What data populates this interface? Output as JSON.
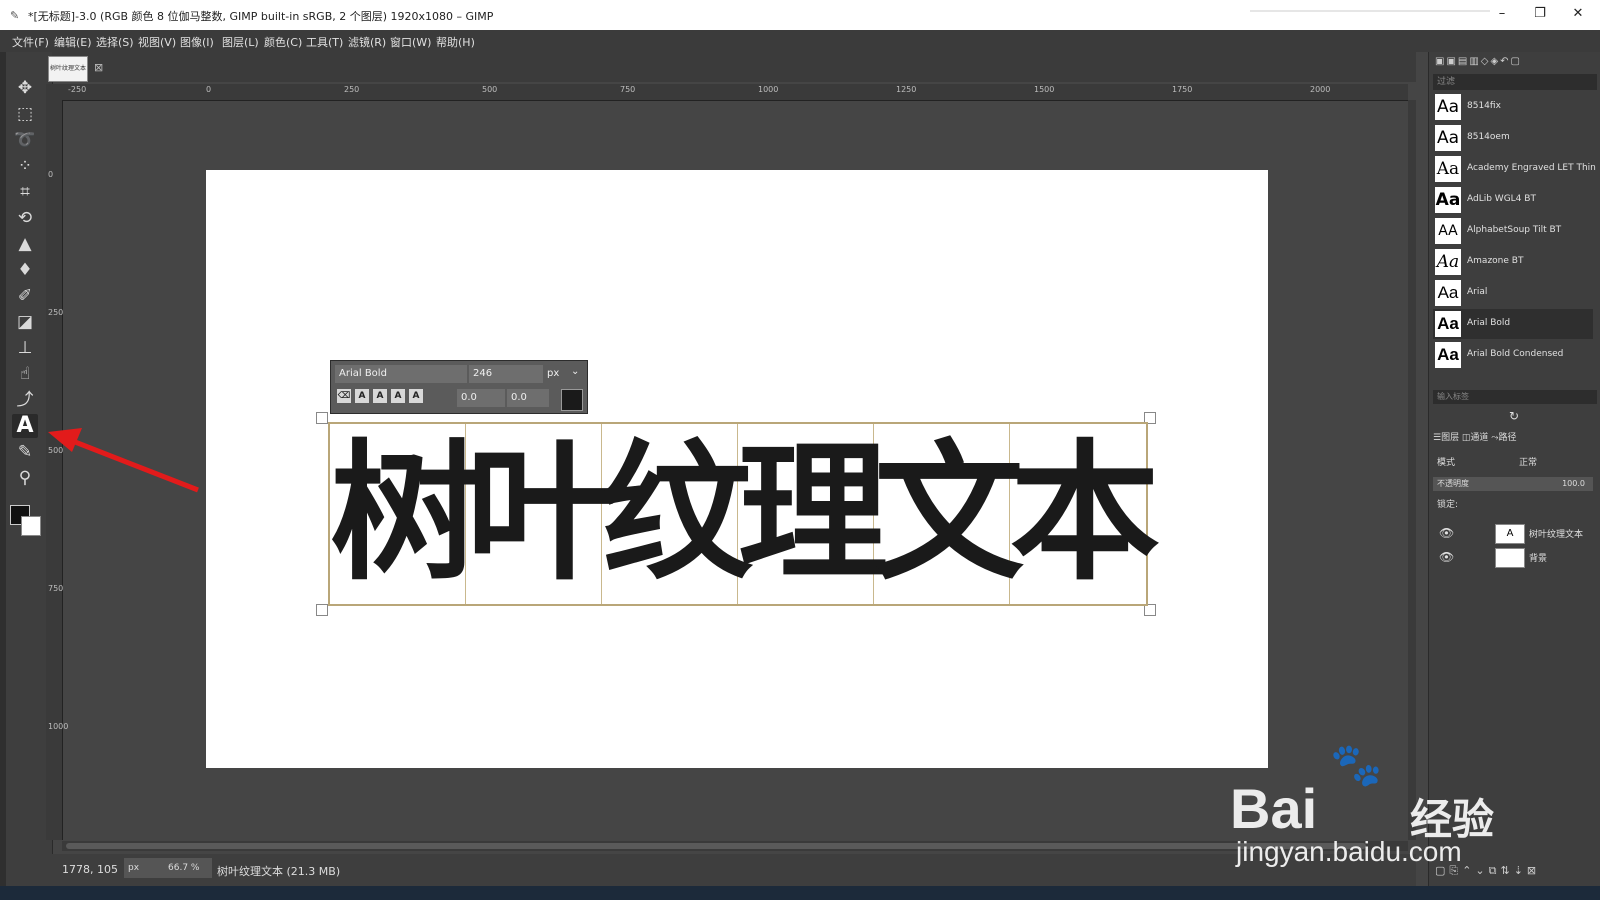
{
  "window": {
    "title": "*[无标题]-3.0 (RGB 颜色 8 位伽马整数, GIMP built-in sRGB, 2 个图层) 1920x1080 – GIMP",
    "controls": [
      "–",
      "❐",
      "✕"
    ]
  },
  "menubar": [
    "文件(F)",
    "编辑(E)",
    "选择(S)",
    "视图(V)",
    "图像(I)",
    "图层(L)",
    "颜色(C)",
    "工具(T)",
    "滤镜(R)",
    "窗口(W)",
    "帮助(H)"
  ],
  "image_tab": {
    "thumb_text": "树叶纹理文本",
    "close": "⊠"
  },
  "rulers": {
    "horizontal": [
      "-250",
      "0",
      "250",
      "500",
      "750",
      "1000",
      "1250",
      "1500",
      "1750",
      "2000"
    ],
    "vertical": [
      "0",
      "250",
      "500",
      "750",
      "1000"
    ]
  },
  "canvas_text": [
    "树",
    "叶",
    "纹",
    "理",
    "文",
    "本"
  ],
  "text_toolbar": {
    "font": "Arial Bold",
    "size": "246",
    "unit": "px",
    "offset_x": "0.0",
    "offset_y": "0.0",
    "buttons": [
      "⌫",
      "A",
      "A",
      "A",
      "A"
    ]
  },
  "status": {
    "coords": "1778, 105",
    "unit": "px",
    "zoom": "66.7 %",
    "info": "树叶纹理文本 (21.3 MB)"
  },
  "fonts_panel": {
    "filter_placeholder": "过滤",
    "tags_placeholder": "输入标签",
    "fonts": [
      {
        "preview": "Aa",
        "name": "8514fix"
      },
      {
        "preview": "Aa",
        "name": "8514oem"
      },
      {
        "preview": "Aa",
        "name": "Academy Engraved LET Thin"
      },
      {
        "preview": "Aa",
        "name": "AdLib WGL4 BT"
      },
      {
        "preview": "AA",
        "name": "AlphabetSoup Tilt BT"
      },
      {
        "preview": "Aa",
        "name": "Amazone BT"
      },
      {
        "preview": "Aa",
        "name": "Arial"
      },
      {
        "preview": "Aa",
        "name": "Arial Bold"
      },
      {
        "preview": "Aa",
        "name": "Arial Bold Condensed"
      }
    ],
    "selected_font": "Arial Bold"
  },
  "layers_panel": {
    "tabs": "☰图层  ◫通道  ⤳路径",
    "mode_label": "模式",
    "mode_value": "正常",
    "opacity_label": "不透明度",
    "opacity_value": "100.0",
    "lock_label": "锁定:",
    "layers": [
      {
        "thumb": "A",
        "name": "树叶纹理文本"
      },
      {
        "thumb": "",
        "name": "背景"
      }
    ]
  },
  "watermark": {
    "brand": "Bai",
    "brand_cn": "经验",
    "url": "jingyan.baidu.com",
    "paw": "🐾"
  },
  "colors": {
    "accent_arrow": "#e21b1b",
    "canvas": "#ffffff",
    "workspace": "#454545"
  }
}
